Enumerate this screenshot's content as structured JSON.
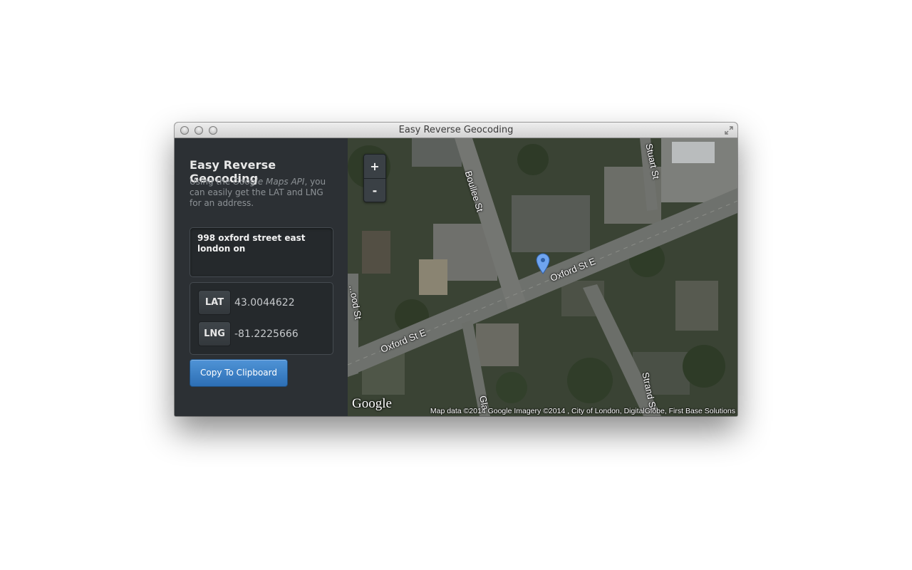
{
  "window": {
    "title": "Easy Reverse Geocoding"
  },
  "sidebar": {
    "title": "Easy Reverse Geocoding",
    "description_prefix": "Using the ",
    "description_emphasis": "Google Maps API",
    "description_suffix": ", you can easily get the LAT and LNG for an address.",
    "address_value": "998 oxford street east london on",
    "lat_label": "LAT",
    "lat_value": "43.0044622",
    "lng_label": "LNG",
    "lng_value": "-81.2225666",
    "copy_button_label": "Copy To Clipboard"
  },
  "map": {
    "zoom_in_label": "+",
    "zoom_out_label": "-",
    "streets": {
      "boullee": "Boullee St",
      "stuart": "Stuart St",
      "oxford_main": "Oxford St E",
      "oxford_left": "Oxford St E",
      "wood": "...ood St",
      "strand": "Strand St",
      "gla": "Gla"
    },
    "logo": "Google",
    "attribution": "Map data ©2014 Google  Imagery ©2014 , City of London, DigitalGlobe, First Base Solutions",
    "colors": {
      "accent_button": "#3a80c8",
      "marker": "#6fa4f0"
    }
  }
}
